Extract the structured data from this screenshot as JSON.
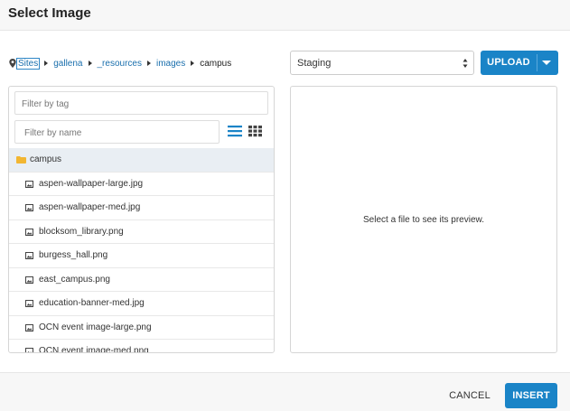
{
  "dialog": {
    "title": "Select Image"
  },
  "breadcrumb": {
    "items": [
      "Sites",
      "gallena",
      "_resources",
      "images"
    ],
    "current": "campus"
  },
  "site_select": {
    "value": "Staging"
  },
  "upload": {
    "label": "UPLOAD"
  },
  "filters": {
    "tag_placeholder": "Filter by tag",
    "name_placeholder": "Filter by name"
  },
  "file_list": {
    "folder": "campus",
    "files": [
      "aspen-wallpaper-large.jpg",
      "aspen-wallpaper-med.jpg",
      "blocksom_library.png",
      "burgess_hall.png",
      "east_campus.png",
      "education-banner-med.jpg",
      "OCN event image-large.png",
      "OCN event image-med.png"
    ]
  },
  "preview": {
    "message": "Select a file to see its preview."
  },
  "footer": {
    "cancel_label": "CANCEL",
    "insert_label": "INSERT"
  },
  "colors": {
    "accent": "#1a84c7",
    "link": "#1a6fad",
    "folder": "#f2b632",
    "selected_row": "#e9eef3"
  }
}
